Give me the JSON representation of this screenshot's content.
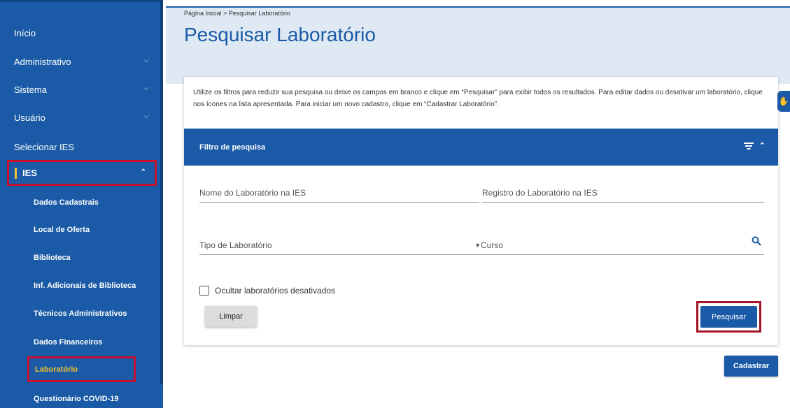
{
  "sidebar": {
    "items": [
      {
        "label": "Início"
      },
      {
        "label": "Administrativo"
      },
      {
        "label": "Sistema"
      },
      {
        "label": "Usuário"
      },
      {
        "label": "Selecionar IES"
      },
      {
        "label": "IES"
      }
    ],
    "subitems": [
      {
        "label": "Dados Cadastrais"
      },
      {
        "label": "Local de Oferta"
      },
      {
        "label": "Biblioteca"
      },
      {
        "label": "Inf. Adicionais de Biblioteca"
      },
      {
        "label": "Técnicos Administrativos"
      },
      {
        "label": "Dados Financeiros"
      },
      {
        "label": "Laboratório"
      },
      {
        "label": "Questionário COVID-19"
      }
    ]
  },
  "header": {
    "breadcrumb": "Página Inicial > Pesquisar Laboratório",
    "title": "Pesquisar Laboratório"
  },
  "intro": "Utilize os filtros para reduzir sua pesquisa ou deixe os campos em branco e clique em “Pesquisar” para exibir todos os resultados. Para editar dados ou desativar um laboratório, clique nos ícones na lista apresentada. Para iniciar um novo cadastro, clique em “Cadastrar Laboratório”.",
  "filter": {
    "title": "Filtro de pesquisa",
    "fields": {
      "nome": "Nome do Laboratório na IES",
      "registro": "Registro do Laboratório na IES",
      "tipo": "Tipo de Laboratório",
      "curso": "Curso"
    },
    "checkbox_label": "Ocultar laboratórios desativados",
    "clear_label": "Limpar",
    "search_label": "Pesquisar"
  },
  "actions": {
    "cadastrar_label": "Cadastrar"
  },
  "colors": {
    "primary": "#1a5aa6",
    "highlight": "#c8102e",
    "active_text": "#f2c230"
  },
  "icons": [
    "chevron-down-icon",
    "chevron-up-icon",
    "filter-icon",
    "search-icon",
    "accessibility-icon"
  ]
}
